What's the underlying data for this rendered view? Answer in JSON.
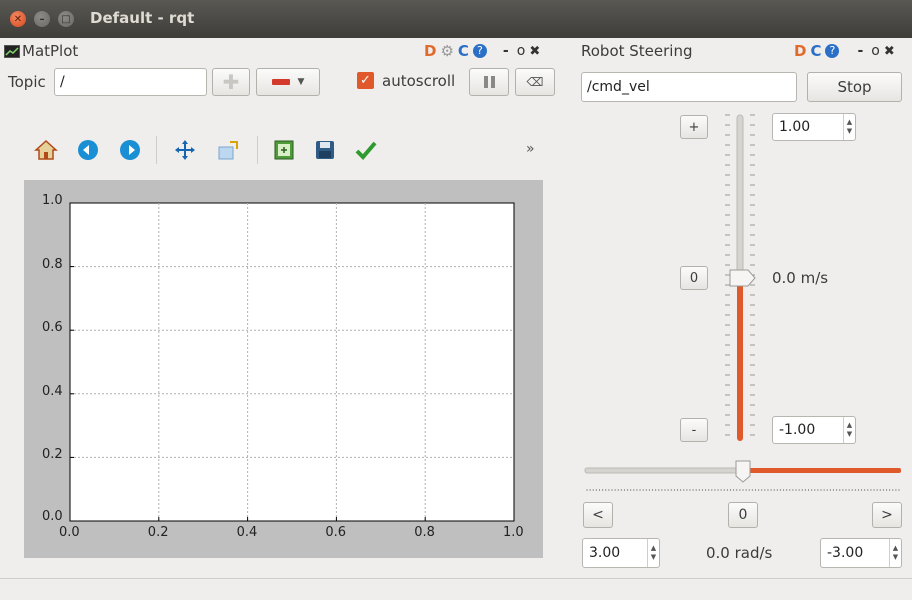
{
  "window": {
    "title": "Default - rqt"
  },
  "matplot": {
    "title": "MatPlot",
    "topic_label": "Topic",
    "topic_value": "/",
    "autoscroll_label": "autoscroll",
    "autoscroll_checked": true,
    "dock_icons": [
      "D",
      "gear-icon",
      "refresh-icon",
      "help-icon"
    ],
    "dock_min": "-",
    "dock_float": "o",
    "dock_close": "✖",
    "overflow": "»",
    "axes": {
      "xticks": [
        "0.0",
        "0.2",
        "0.4",
        "0.6",
        "0.8",
        "1.0"
      ],
      "yticks": [
        "0.0",
        "0.2",
        "0.4",
        "0.6",
        "0.8",
        "1.0"
      ]
    }
  },
  "steering": {
    "title": "Robot Steering",
    "topic_value": "/cmd_vel",
    "stop_label": "Stop",
    "plus_label": "+",
    "zero_label": "0",
    "minus_label": "-",
    "max_linear": "1.00",
    "min_linear": "-1.00",
    "linear_readout": "0.0 m/s",
    "left_label": "<",
    "angular_zero": "0",
    "right_label": ">",
    "max_angular": "3.00",
    "angular_readout": "0.0 rad/s",
    "min_angular": "-3.00",
    "dock_min": "-",
    "dock_float": "o",
    "dock_close": "✖"
  },
  "colors": {
    "accent": "#e0592b",
    "titlebar": "#3e3d39"
  }
}
